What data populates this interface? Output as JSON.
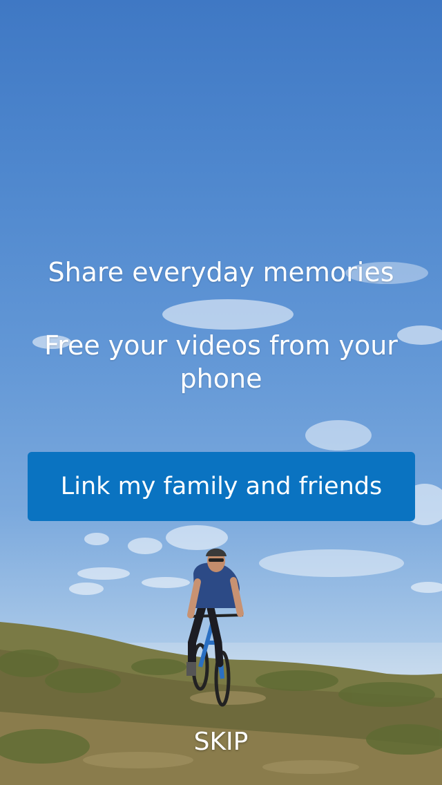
{
  "onboarding": {
    "headline_primary": "Share everyday memories",
    "headline_secondary": "Free your videos from your phone",
    "cta_label": "Link my family and friends",
    "skip_label": "SKIP"
  },
  "colors": {
    "cta_background": "#0a73c1",
    "text": "#ffffff",
    "sky_top": "#3f78c4",
    "sky_bottom": "#c9dcee",
    "ground": "#7d7a45"
  },
  "background": {
    "icon": "cyclist-on-hill-photo"
  }
}
